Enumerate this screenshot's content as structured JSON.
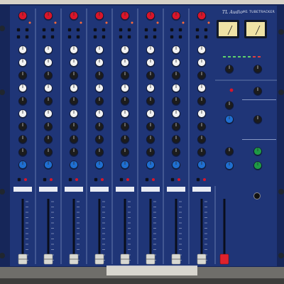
{
  "photo": {
    "subject": "TL Audio M1 Tubetracker analog mixing console, top view",
    "channel_count": 8
  },
  "console": {
    "brand": "TL Audio",
    "model": "M1 TUBETRACKER"
  },
  "colors": {
    "panel": "#1f3577",
    "panel_edge": "#162659",
    "channel_divider": "#9fb0d6",
    "knob_red": "#d9152a",
    "knob_white": "#f2f2f2",
    "knob_black": "#1c1c1c",
    "knob_blue": "#1f6fd1",
    "knob_green": "#1e9a45",
    "fader_cap": "#d8d8d2",
    "master_fader_cap": "#e0212c",
    "vu_face": "#efe3a6",
    "background_wall": "#ebe7e0"
  }
}
